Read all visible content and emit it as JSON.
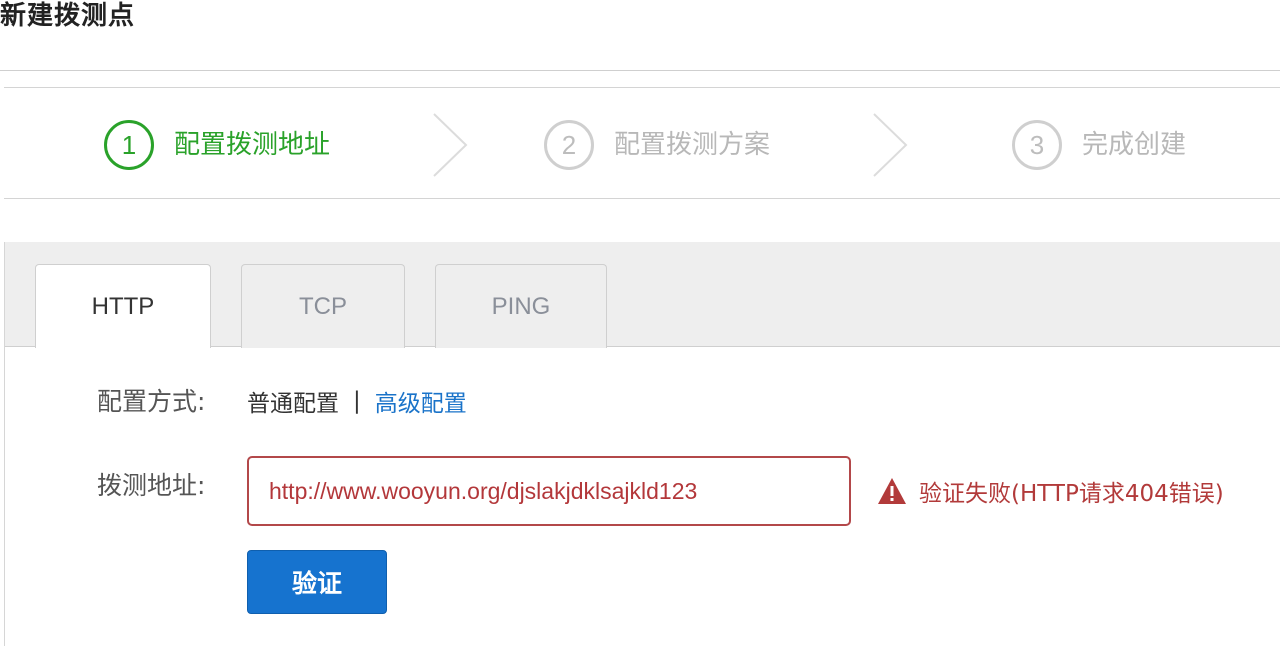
{
  "page": {
    "title": "新建拨测点"
  },
  "steps": [
    {
      "num": "1",
      "label": "配置拨测地址",
      "state": "active"
    },
    {
      "num": "2",
      "label": "配置拨测方案",
      "state": "inactive"
    },
    {
      "num": "3",
      "label": "完成创建",
      "state": "inactive"
    }
  ],
  "tabs": [
    {
      "label": "HTTP",
      "active": true
    },
    {
      "label": "TCP",
      "active": false
    },
    {
      "label": "PING",
      "active": false
    }
  ],
  "form": {
    "config_mode_label": "配置方式:",
    "config_mode_current": "普通配置",
    "config_mode_separator": "|",
    "config_mode_link": "高级配置",
    "url_label": "拨测地址:",
    "url_value": "http://www.wooyun.org/djslakjdklsajkld123",
    "error_text": "验证失败(HTTP请求404错误)",
    "verify_button": "验证"
  },
  "colors": {
    "active_step": "#2aa22a",
    "inactive_step": "#b8b8b8",
    "error": "#b23a3a",
    "primary_button": "#1673cf",
    "link": "#1a73c9"
  },
  "icons": {
    "step_arrow": "chevron-right-icon",
    "error": "warning-triangle-icon"
  }
}
